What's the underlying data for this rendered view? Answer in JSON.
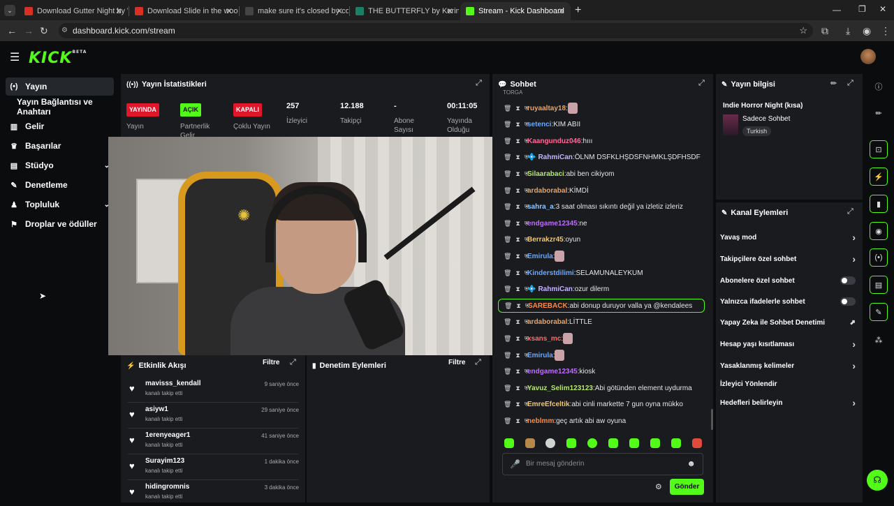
{
  "browser": {
    "tabs": [
      {
        "title": "Download Gutter Night by Wa",
        "fav_color": "#d93025"
      },
      {
        "title": "Download Slide in the woods b",
        "fav_color": "#d93025"
      },
      {
        "title": "make sure it's closed by corpse",
        "fav_color": "#444444"
      },
      {
        "title": "THE BUTTERFLY by Kerineia",
        "fav_color": "#1a7f64"
      },
      {
        "title": "Stream - Kick Dashboard",
        "fav_color": "#53fc18"
      }
    ],
    "url": "dashboard.kick.com/stream",
    "new_tab": "+"
  },
  "app": {
    "logo": "KICK",
    "logo_tag": "BETA",
    "accent": "#53fc18"
  },
  "sidebar": {
    "items": [
      {
        "label": "Yayın",
        "icon": "(•)"
      },
      {
        "label": "Yayın Bağlantısı ve Anahtarı",
        "icon": ""
      },
      {
        "label": "Gelir",
        "icon": "▥"
      },
      {
        "label": "Başarılar",
        "icon": "♛"
      },
      {
        "label": "Stüdyo",
        "icon": "▤"
      },
      {
        "label": "Denetleme",
        "icon": "✎"
      },
      {
        "label": "Topluluk",
        "icon": "♟"
      },
      {
        "label": "Droplar ve ödüller",
        "icon": "⚑"
      }
    ]
  },
  "stats": {
    "title": "Yayın İstatistikleri",
    "items": [
      {
        "badge": "YAYINDA",
        "label": "Yayın"
      },
      {
        "badge": "AÇIK",
        "label": "Partnerlik Gelir"
      },
      {
        "badge": "KAPALI",
        "label": "Çoklu Yayın"
      },
      {
        "value": "257",
        "label": "İzleyici"
      },
      {
        "value": "12.188",
        "label": "Takipçi"
      },
      {
        "value": "-",
        "label": "Abone Sayısı"
      },
      {
        "value": "00:11:05",
        "label": "Yayında Olduğu"
      }
    ]
  },
  "events": {
    "title": "Etkinlik Akışı",
    "filter": "Filtre",
    "items": [
      {
        "name": "mavisss_kendall",
        "sub": "kanalı takip etti",
        "time": "9 saniye önce"
      },
      {
        "name": "asiyw1",
        "sub": "kanalı takip etti",
        "time": "29 saniye önce"
      },
      {
        "name": "1erenyeager1",
        "sub": "kanalı takip etti",
        "time": "41 saniye önce"
      },
      {
        "name": "Surayim123",
        "sub": "kanalı takip etti",
        "time": "1 dakika önce"
      },
      {
        "name": "hidingromnis",
        "sub": "kanalı takip etti",
        "time": "3 dakika önce"
      }
    ]
  },
  "moderation": {
    "title": "Denetim Eylemleri",
    "filter": "Filtre"
  },
  "chat": {
    "title": "Sohbet",
    "messages": [
      {
        "user": "ruyaaltay18",
        "color": "#f0a35e",
        "text": ""
      },
      {
        "user": "setenci",
        "color": "#6aa9ff",
        "text": "KIM ABII"
      },
      {
        "user": "Kaangunduz046",
        "color": "#ff6b9a",
        "text": "hııı"
      },
      {
        "user": "RahmiCan",
        "color": "#c5b3ff",
        "text": "ÖLNM DSFKLHŞDSFNHMKLŞDFHSDF"
      },
      {
        "user": "Silaarabaci",
        "color": "#b5e86b",
        "text": "abi ben cikiyom"
      },
      {
        "user": "ardaborabal",
        "color": "#f0a35e",
        "text": "KİMDİ"
      },
      {
        "user": "sahra_a",
        "color": "#8ec7ff",
        "text": "3 saat olması sıkıntı değil ya izletiz izleriz"
      },
      {
        "user": "endgame12345",
        "color": "#c06bff",
        "text": "ne"
      },
      {
        "user": "Berrakzr45",
        "color": "#f5c66b",
        "text": "oyun"
      },
      {
        "user": "Emirula",
        "color": "#6aa9ff",
        "text": ""
      },
      {
        "user": "Kinderstdilimi",
        "color": "#6aa9ff",
        "text": "SELAMUNALEYKUM"
      },
      {
        "user": "RahmiCan",
        "color": "#c5b3ff",
        "text": "ozur dilerm"
      },
      {
        "user": "SAREBACK",
        "color": "#ff8a3d",
        "text": "abi donup duruyor valla ya @kendalees"
      },
      {
        "user": "ardaborabal",
        "color": "#f0a35e",
        "text": "LİTTLE"
      },
      {
        "user": "xsans_mc",
        "color": "#ff6b6b",
        "text": ""
      },
      {
        "user": "Emirula",
        "color": "#6aa9ff",
        "text": ""
      },
      {
        "user": "endgame12345",
        "color": "#c06bff",
        "text": "kiosk"
      },
      {
        "user": "Yavuz_Selim123123",
        "color": "#b5e86b",
        "text": "Abi götünden element uydurma"
      },
      {
        "user": "EmreEfceltik",
        "color": "#f5c66b",
        "text": "abi cinli markette 7 gun oyna mükko"
      },
      {
        "user": "neblmm",
        "color": "#ff8a3d",
        "text": "geç artık abi aw oyuna"
      }
    ],
    "placeholder": "Bir mesaj gönderin",
    "send": "Gönder",
    "top_cut": "TORGA"
  },
  "stream_info": {
    "title": "Yayın bilgisi",
    "stream_title": "Indie Horror Night (kısa)",
    "category": "Sadece Sohbet",
    "tag": "Turkish"
  },
  "channel_actions": {
    "title": "Kanal Eylemleri",
    "items": [
      {
        "label": "Yavaş mod",
        "ctrl": "chevron"
      },
      {
        "label": "Takipçilere özel sohbet",
        "ctrl": "chevron"
      },
      {
        "label": "Abonelere özel sohbet",
        "ctrl": "toggle"
      },
      {
        "label": "Yalnızca ifadelerle sohbet",
        "ctrl": "toggle"
      },
      {
        "label": "Yapay Zeka ile Sohbet Denetimi",
        "ctrl": "ext"
      },
      {
        "label": "Hesap yaşı kısıtlaması",
        "ctrl": "chevron"
      },
      {
        "label": "Yasaklanmış kelimeler",
        "ctrl": "chevron"
      },
      {
        "label": "İzleyici Yönlendir",
        "ctrl": "none"
      },
      {
        "label": "Hedefleri belirleyin",
        "ctrl": "chevron"
      }
    ]
  }
}
